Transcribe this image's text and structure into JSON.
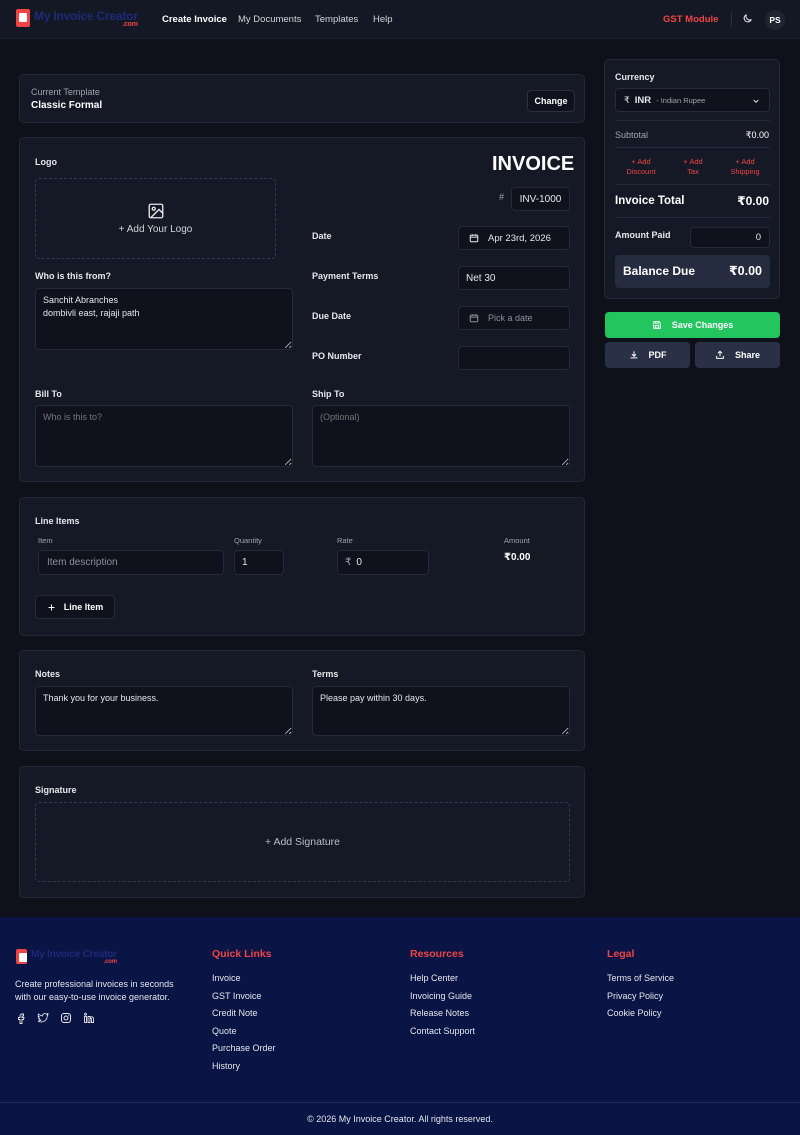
{
  "header": {
    "logo_text": "My Invoice Creator",
    "logo_suffix": ".com",
    "nav": [
      "Create Invoice",
      "My Documents",
      "Templates",
      "Help"
    ],
    "gst_module": "GST Module",
    "avatar_initials": "PS"
  },
  "template": {
    "label": "Current Template",
    "name": "Classic Formal",
    "change_label": "Change"
  },
  "invoice": {
    "logo_label": "Logo",
    "add_logo": "+ Add Your Logo",
    "title": "INVOICE",
    "number_prefix": "#",
    "number": "INV-1000",
    "date_label": "Date",
    "date_value": "Apr 23rd, 2026",
    "payment_terms_label": "Payment Terms",
    "payment_terms_value": "Net 30",
    "due_date_label": "Due Date",
    "due_date_placeholder": "Pick a date",
    "po_label": "PO Number",
    "from_label": "Who is this from?",
    "from_value": "Sanchit Abranches\ndombivli east, rajaji path",
    "bill_to_label": "Bill To",
    "bill_to_placeholder": "Who is this to?",
    "ship_to_label": "Ship To",
    "ship_to_placeholder": "(Optional)"
  },
  "line_items": {
    "title": "Line Items",
    "headers": {
      "item": "Item",
      "quantity": "Quantity",
      "rate": "Rate",
      "amount": "Amount"
    },
    "row": {
      "item_placeholder": "Item description",
      "quantity": "1",
      "rate_symbol": "₹",
      "rate": "0",
      "amount": "₹0.00"
    },
    "add_label": "Line Item"
  },
  "notes": {
    "notes_label": "Notes",
    "notes_value": "Thank you for your business.",
    "terms_label": "Terms",
    "terms_value": "Please pay within 30 days."
  },
  "signature": {
    "label": "Signature",
    "add_label": "+ Add Signature"
  },
  "summary": {
    "currency_label": "Currency",
    "currency_symbol": "₹",
    "currency_code": "INR",
    "currency_name": "- Indian Rupee",
    "subtotal_label": "Subtotal",
    "subtotal_value": "₹0.00",
    "add_discount": "+ Add\nDiscount",
    "add_tax": "+ Add\nTax",
    "add_shipping": "+ Add\nShipping",
    "total_label": "Invoice Total",
    "total_value": "₹0.00",
    "amount_paid_label": "Amount Paid",
    "amount_paid_value": "0",
    "balance_label": "Balance Due",
    "balance_value": "₹0.00",
    "save_label": "Save Changes",
    "pdf_label": "PDF",
    "share_label": "Share",
    "colors": {
      "accent_red": "#ef4444",
      "save_green": "#22c55e"
    }
  },
  "footer": {
    "tagline": "Create professional invoices in seconds\nwith our easy-to-use invoice generator.",
    "quick_links_title": "Quick Links",
    "quick_links": [
      "Invoice",
      "GST Invoice",
      "Credit Note",
      "Quote",
      "Purchase Order",
      "History"
    ],
    "resources_title": "Resources",
    "resources": [
      "Help Center",
      "Invoicing Guide",
      "Release Notes",
      "Contact Support"
    ],
    "legal_title": "Legal",
    "legal": [
      "Terms of Service",
      "Privacy Policy",
      "Cookie Policy"
    ],
    "copyright": "© 2026 My Invoice Creator. All rights reserved.",
    "social_icons": [
      "facebook-icon",
      "twitter-icon",
      "instagram-icon",
      "linkedin-icon"
    ]
  }
}
